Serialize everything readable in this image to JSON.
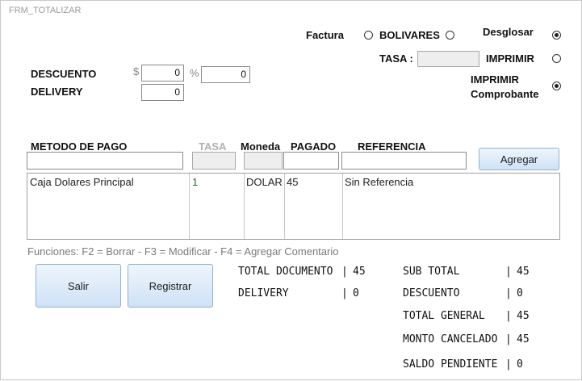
{
  "window": {
    "title": "FRM_TOTALIZAR"
  },
  "options": {
    "factura_label": "Factura",
    "bolivares_label": "BOLIVARES",
    "desglosar_label": "Desglosar",
    "tasa_label": "TASA :",
    "tasa_value": "",
    "imprimir_label": "IMPRIMIR",
    "imprimir_comprobante_label_1": "IMPRIMIR",
    "imprimir_comprobante_label_2": "Comprobante"
  },
  "discount": {
    "descuento_label": "DESCUENTO",
    "currency_symbol": "$",
    "amount_value": "0",
    "percent_symbol": "%",
    "percent_value": "0",
    "delivery_label": "DELIVERY",
    "delivery_value": "0"
  },
  "payment": {
    "headers": {
      "metodo": "METODO DE PAGO",
      "tasa": "TASA",
      "moneda": "Moneda",
      "pagado": "PAGADO",
      "referencia": "REFERENCIA"
    },
    "inputs": {
      "metodo": "",
      "tasa": "",
      "moneda": "",
      "pagado": "",
      "referencia": ""
    },
    "add_button": "Agregar",
    "rows": [
      {
        "metodo": "Caja Dolares Principal",
        "tasa": "1",
        "moneda": "DOLAR",
        "pagado": "45",
        "referencia": "Sin Referencia"
      }
    ]
  },
  "functions_hint": "Funciones: F2 = Borrar - F3 = Modificar - F4 = Agregar Comentario",
  "buttons": {
    "salir": "Salir",
    "registrar": "Registrar"
  },
  "totals_left": [
    {
      "label": "TOTAL DOCUMENTO",
      "value": "45"
    },
    {
      "label": "DELIVERY",
      "value": "0"
    }
  ],
  "totals_right": [
    {
      "label": "SUB TOTAL",
      "value": "45"
    },
    {
      "label": "DESCUENTO",
      "value": "0"
    },
    {
      "label": "TOTAL GENERAL",
      "value": "45"
    },
    {
      "label": "MONTO CANCELADO",
      "value": "45"
    },
    {
      "label": "SALDO PENDIENTE",
      "value": "0"
    }
  ],
  "separator": "|"
}
